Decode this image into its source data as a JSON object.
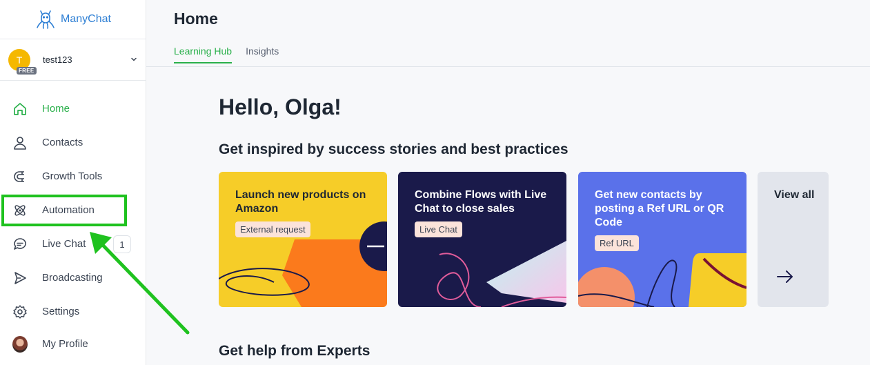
{
  "brand": {
    "name": "ManyChat",
    "logo_icon": "octopus-logo-icon",
    "color": "#2e7fd4"
  },
  "account": {
    "initial": "T",
    "plan_badge": "FREE",
    "name": "test123"
  },
  "nav": [
    {
      "label": "Home",
      "icon": "home-icon",
      "active": true
    },
    {
      "label": "Contacts",
      "icon": "person-icon"
    },
    {
      "label": "Growth Tools",
      "icon": "magnet-icon"
    },
    {
      "label": "Automation",
      "icon": "atom-icon"
    },
    {
      "label": "Live Chat",
      "icon": "chat-bubble-icon",
      "badge": "1"
    },
    {
      "label": "Broadcasting",
      "icon": "send-icon"
    },
    {
      "label": "Settings",
      "icon": "gear-icon"
    },
    {
      "label": "My Profile",
      "icon": "profile-avatar"
    }
  ],
  "header": {
    "title": "Home",
    "tabs": [
      {
        "label": "Learning Hub",
        "active": true
      },
      {
        "label": "Insights"
      }
    ]
  },
  "main": {
    "greeting": "Hello, Olga!",
    "inspired_title": "Get inspired by success stories and best practices",
    "cards": [
      {
        "title": "Launch new products on Amazon",
        "tag": "External request"
      },
      {
        "title": "Combine Flows with Live Chat to close sales",
        "tag": "Live Chat"
      },
      {
        "title": "Get new contacts by posting a Ref URL or QR Code",
        "tag": "Ref URL"
      },
      {
        "title": "View all",
        "icon": "arrow-right-icon"
      }
    ],
    "experts_title": "Get help from Experts"
  },
  "colors": {
    "accent": "#2ab04b",
    "highlight": "#1fc21f"
  }
}
